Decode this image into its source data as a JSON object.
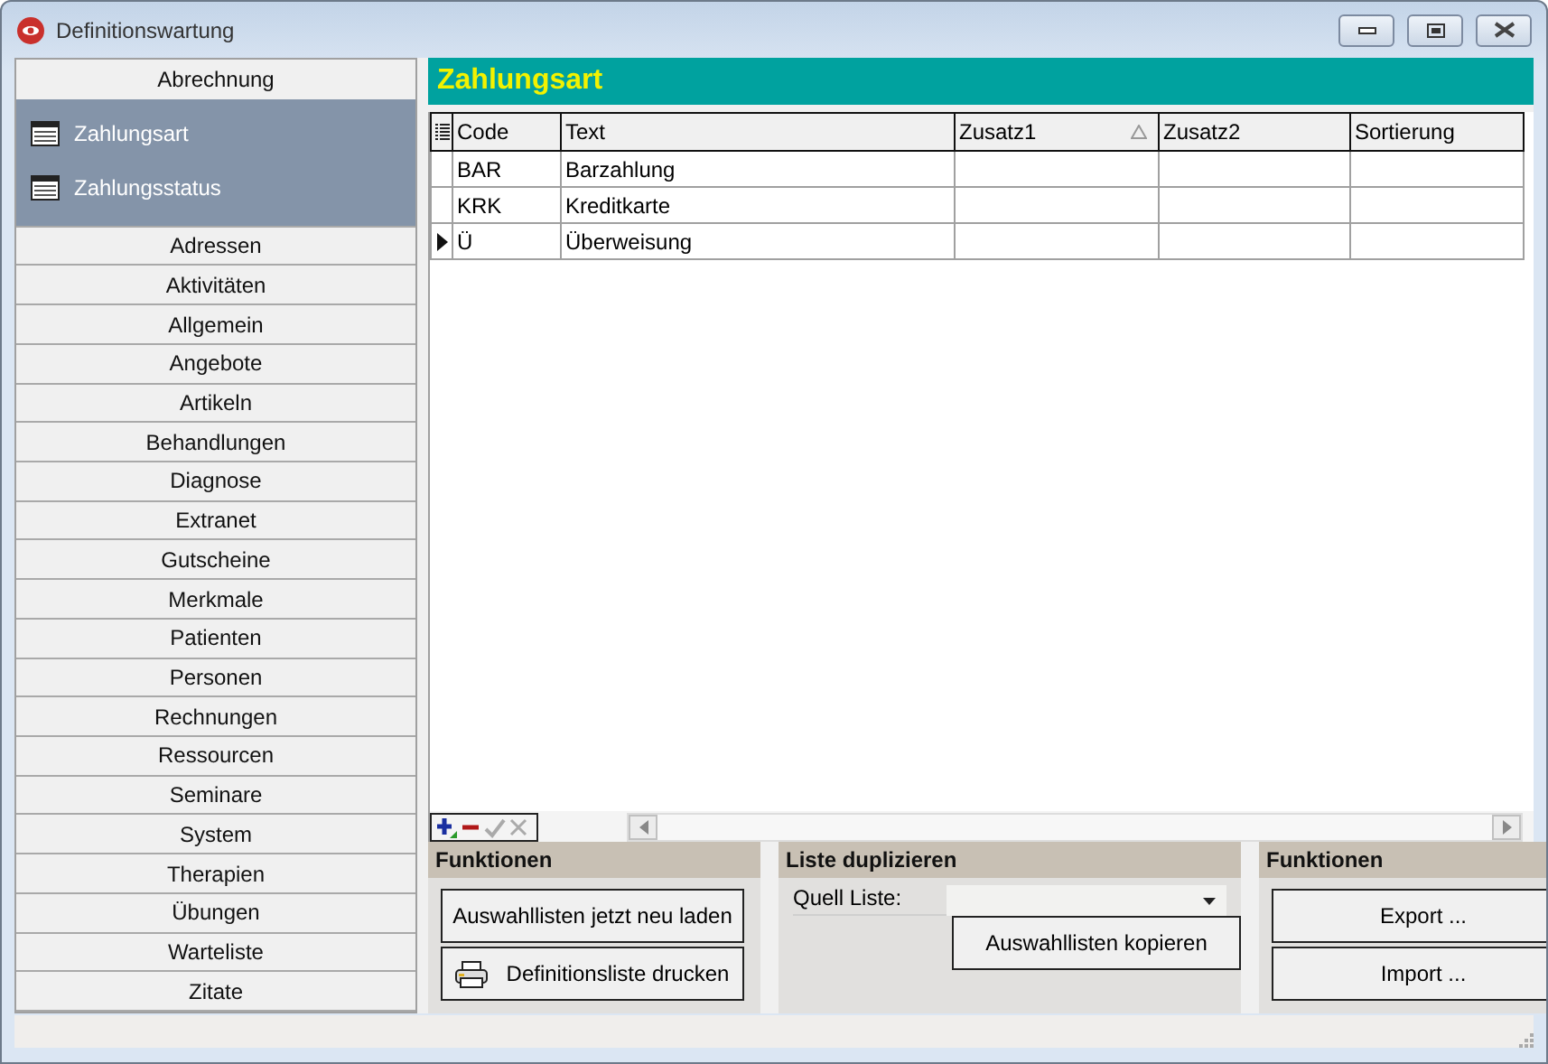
{
  "window": {
    "title": "Definitionswartung"
  },
  "sidebar": {
    "groups": [
      {
        "label": "Abrechnung",
        "expanded": true,
        "children": [
          {
            "label": "Zahlungsart"
          },
          {
            "label": "Zahlungsstatus"
          }
        ]
      },
      {
        "label": "Adressen",
        "expanded": false
      },
      {
        "label": "Aktivitäten",
        "expanded": false
      },
      {
        "label": "Allgemein",
        "expanded": false
      },
      {
        "label": "Angebote",
        "expanded": false
      },
      {
        "label": "Artikeln",
        "expanded": false
      },
      {
        "label": "Behandlungen",
        "expanded": false
      },
      {
        "label": "Diagnose",
        "expanded": false
      },
      {
        "label": "Extranet",
        "expanded": false
      },
      {
        "label": "Gutscheine",
        "expanded": false
      },
      {
        "label": "Merkmale",
        "expanded": false
      },
      {
        "label": "Patienten",
        "expanded": false
      },
      {
        "label": "Personen",
        "expanded": false
      },
      {
        "label": "Rechnungen",
        "expanded": false
      },
      {
        "label": "Ressourcen",
        "expanded": false
      },
      {
        "label": "Seminare",
        "expanded": false
      },
      {
        "label": "System",
        "expanded": false
      },
      {
        "label": "Therapien",
        "expanded": false
      },
      {
        "label": "Übungen",
        "expanded": false
      },
      {
        "label": "Warteliste",
        "expanded": false
      },
      {
        "label": "Zitate",
        "expanded": false
      }
    ]
  },
  "main": {
    "title": "Zahlungsart",
    "table": {
      "columns": [
        {
          "label": "Code",
          "sorted": false
        },
        {
          "label": "Text",
          "sorted": false
        },
        {
          "label": "Zusatz1",
          "sorted": true
        },
        {
          "label": "Zusatz2",
          "sorted": false
        },
        {
          "label": "Sortierung",
          "sorted": false
        }
      ],
      "rows": [
        {
          "code": "BAR",
          "text": "Barzahlung",
          "current": false
        },
        {
          "code": "KRK",
          "text": "Kreditkarte",
          "current": false
        },
        {
          "code": "Ü",
          "text": "Überweisung",
          "current": true
        }
      ]
    },
    "panels": [
      {
        "title": "Funktionen",
        "kind": "buttons",
        "buttons": [
          {
            "label": "Auswahllisten jetzt neu laden",
            "kind": "plain"
          },
          {
            "label": "Definitionsliste drucken",
            "kind": "printer"
          }
        ]
      },
      {
        "title": "Liste duplizieren",
        "kind": "duplicate",
        "field_label": "Quell Liste:",
        "button": "Auswahllisten kopieren"
      },
      {
        "title": "Funktionen",
        "kind": "buttons",
        "buttons": [
          {
            "label": "Export ...",
            "kind": "plain"
          },
          {
            "label": "Import ...",
            "kind": "plain"
          }
        ]
      }
    ]
  }
}
